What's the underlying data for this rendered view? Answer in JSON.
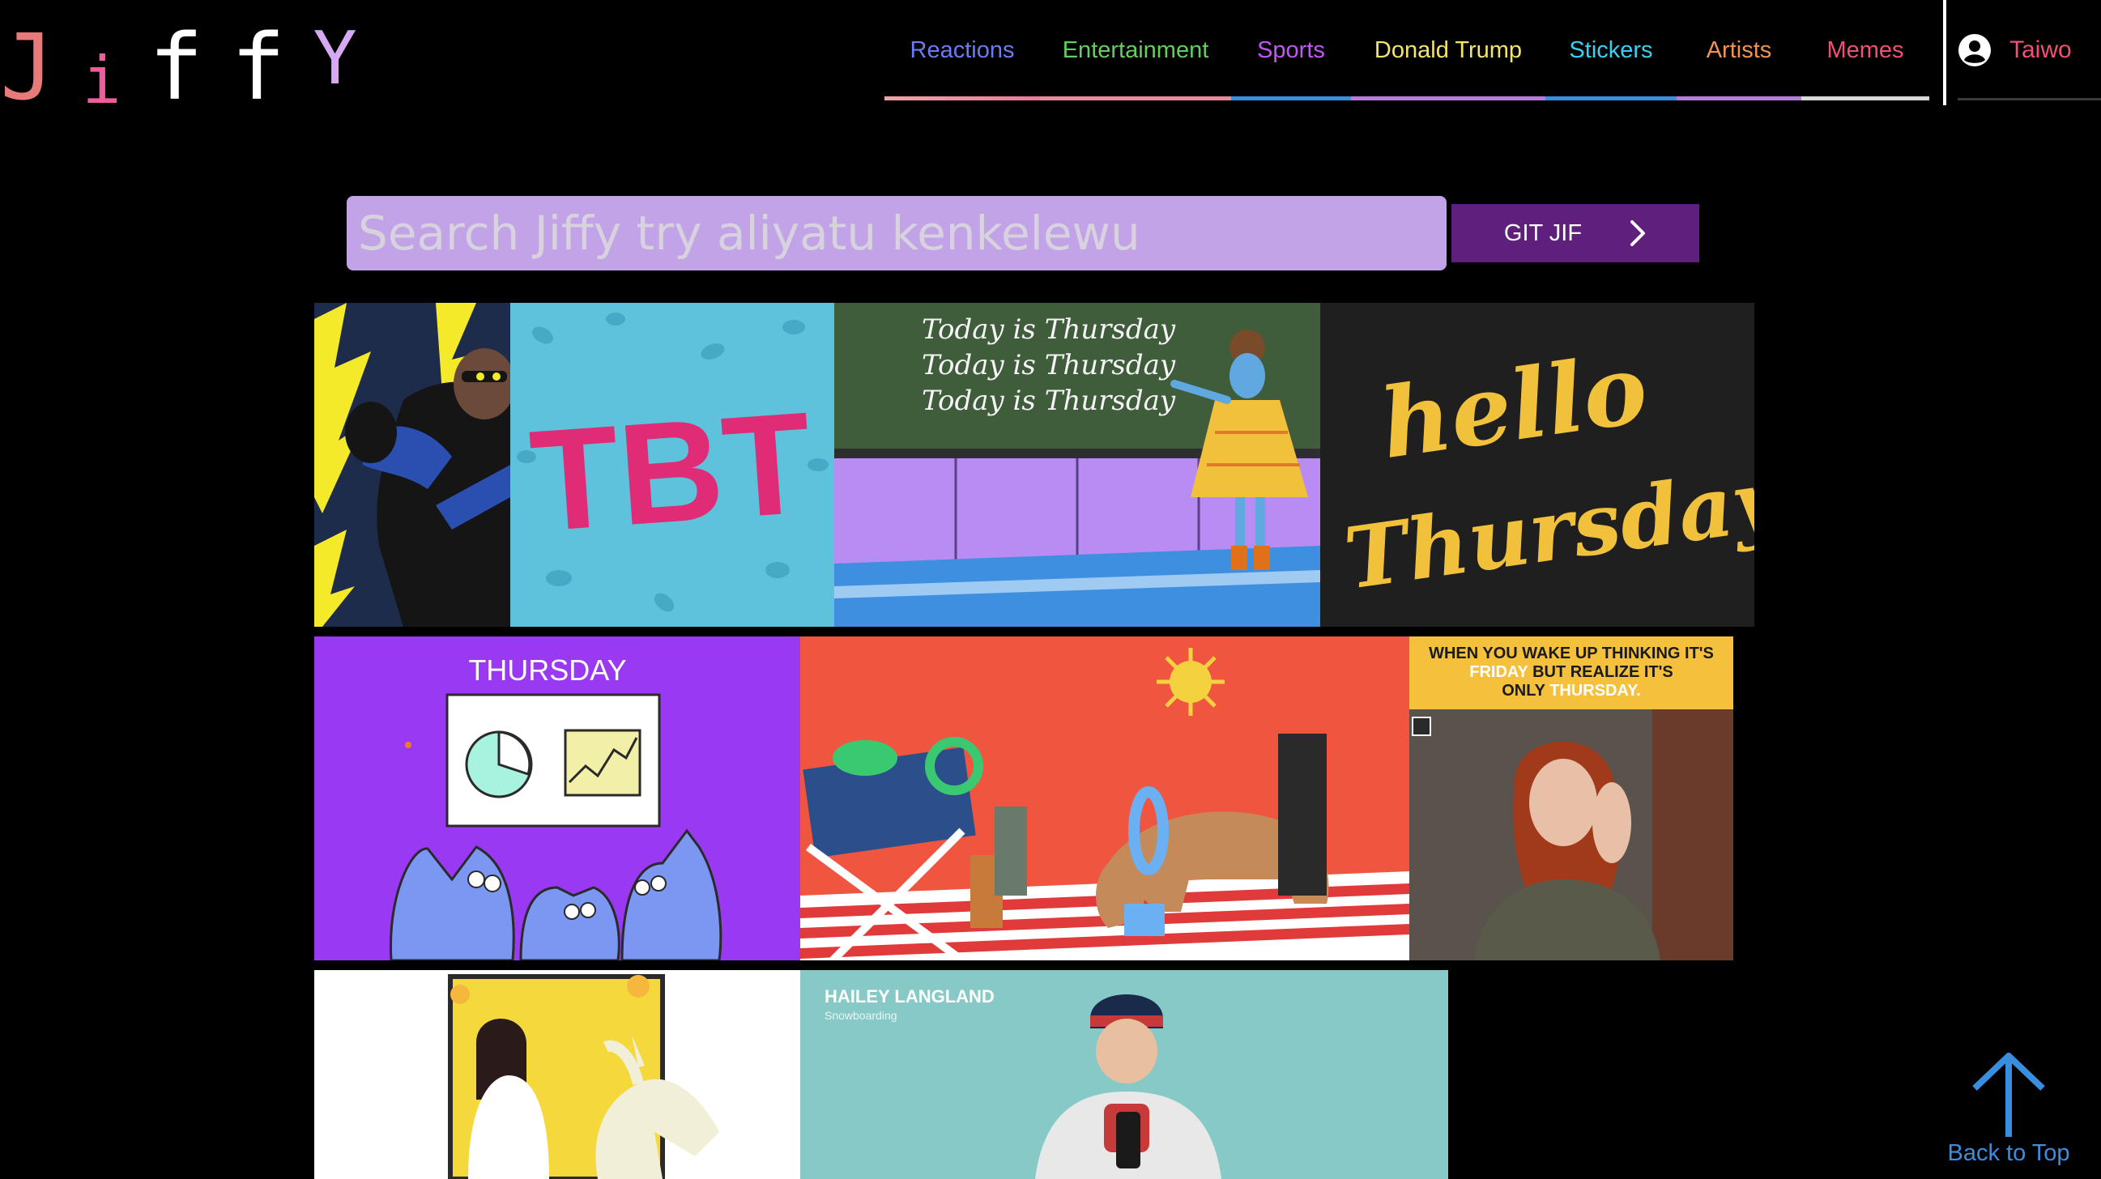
{
  "logo": {
    "letters": [
      "J",
      "i",
      "f",
      "f",
      "Y"
    ],
    "colors": [
      "#e97a7a",
      "#ec5f9c",
      "#ffffff",
      "#ffffff",
      "#d6a9f2"
    ]
  },
  "nav": {
    "items": [
      {
        "label": "Reactions",
        "color": "#6b7cf2"
      },
      {
        "label": "Entertainment",
        "color": "#62cf5c"
      },
      {
        "label": "Sports",
        "color": "#c257f2"
      },
      {
        "label": "Donald Trump",
        "color": "#f3e56b"
      },
      {
        "label": "Stickers",
        "color": "#3ad0f2"
      },
      {
        "label": "Artists",
        "color": "#f2924f"
      },
      {
        "label": "Memes",
        "color": "#f24f73"
      }
    ],
    "user": {
      "name": "Taiwo",
      "name_color": "#f24f73",
      "icon": "user-circle-icon"
    }
  },
  "search": {
    "placeholder": "Search Jiffy try aliyatu kenkelewu",
    "value": "",
    "bg_color": "#c2a3e8",
    "button_label": "GIT JIF",
    "button_color": "#5f1f7c",
    "button_icon": "chevron-right-icon"
  },
  "gifs": [
    {
      "name": "gif-black-lightning",
      "colors": {
        "bg": "#1d2c4b",
        "accent": "#f4ea2a"
      }
    },
    {
      "name": "gif-tbt",
      "text": "TBT",
      "colors": {
        "bg": "#5ec2dd",
        "accent": "#e02c76"
      }
    },
    {
      "name": "gif-today-is-thursday",
      "text": "Today is Thursday",
      "colors": {
        "bg": "#3f5c3b",
        "accent": "#b88cf2"
      }
    },
    {
      "name": "gif-hello-thursday",
      "text": "hello Thursday",
      "colors": {
        "bg": "#1f1f1f",
        "accent": "#f2c13c"
      }
    },
    {
      "name": "gif-thursday-cats",
      "text": "THURSDAY",
      "colors": {
        "bg": "#9a39f2",
        "accent": "#7c97f2"
      }
    },
    {
      "name": "gif-dog-beach",
      "colors": {
        "bg": "#f0553f",
        "accent": "#f4d23f"
      }
    },
    {
      "name": "gif-friday-thursday",
      "text_top": "WHEN YOU WAKE UP THINKING IT'S",
      "text_friday": "FRIDAY",
      "text_mid": "BUT REALIZE IT'S",
      "text_only": "ONLY",
      "text_thursday": "THURSDAY.",
      "colors": {
        "bg": "#f5c13c",
        "accent": "#ffffff"
      }
    },
    {
      "name": "gif-unicorn",
      "colors": {
        "bg": "#ffffff",
        "accent": "#f5d93c"
      }
    },
    {
      "name": "gif-hailey-langland",
      "text": "HAILEY LANGLAND",
      "subtext": "Snowboarding",
      "colors": {
        "bg": "#86c9c7",
        "accent": "#ffffff"
      }
    }
  ],
  "back_to_top": {
    "label": "Back to Top",
    "color": "#3a8ee0",
    "icon": "arrow-up-icon"
  }
}
